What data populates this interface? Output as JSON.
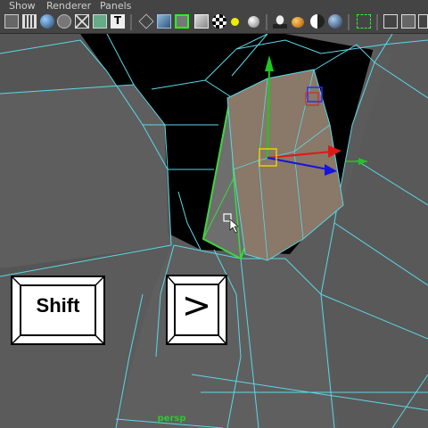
{
  "menu": {
    "items": [
      "Show",
      "Renderer",
      "Panels"
    ]
  },
  "toolbar": {
    "icons": [
      "camera-attributes-icon",
      "film-gate-icon",
      "smooth-shade-icon",
      "flat-shade-icon",
      "wireframe-icon",
      "xray-icon",
      "texture-icon",
      "isolate-icon",
      "default-material-icon",
      "wireframe-on-shaded-icon",
      "shaded-cube-icon",
      "selection-highlight-icon",
      "checker-icon",
      "light-bulb-icon",
      "sphere-icon",
      "shadow-icon",
      "color-ball-icon",
      "half-sphere-icon",
      "shaded-ball-icon",
      "select-camera-icon",
      "cube-wire-icon",
      "cube-icon"
    ]
  },
  "viewport": {
    "camera": "persp"
  },
  "keys": {
    "shift": "Shift",
    "greater": ">"
  },
  "colors": {
    "wire": "#5ad8e8",
    "selection": "#3bd93b",
    "face_fill": "#8a7868",
    "axis_y": "#1ec81e",
    "axis_x": "#e01818",
    "axis_z": "#1414e0",
    "manip": "#e8d000"
  }
}
